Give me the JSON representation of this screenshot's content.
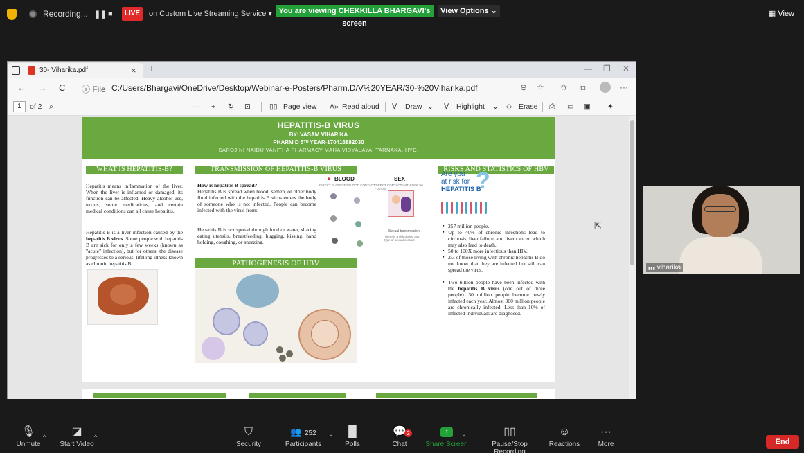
{
  "topbar": {
    "recording_label": "Recording...",
    "pause_icon": "❚❚",
    "stop_icon": "■",
    "live_label": "LIVE",
    "stream_label": "on Custom Live Streaming Service",
    "stream_caret": "▾",
    "viewing_label": "You are viewing CHEKKILLA BHARGAVI's screen",
    "view_options_label": "View Options ⌄",
    "view_label": "▦ View"
  },
  "browser": {
    "tab_title": "30- Viharika.pdf",
    "tab_close": "×",
    "new_tab": "+",
    "minimize": "—",
    "restore": "❐",
    "close": "✕",
    "back": "←",
    "forward": "→",
    "refresh": "C",
    "info": "ⓘ File",
    "url": "C:/Users/Bhargavi/OneDrive/Desktop/Webinar-e-Posters/Pharm.D/V%20YEAR/30-%20Viharika.pdf",
    "zoom_icon": "⊖",
    "fav_icon": "☆",
    "favs_icon": "✩",
    "collections_icon": "⧉",
    "more_icon": "···"
  },
  "pdf_toolbar": {
    "page_number": "1",
    "page_total": "of 2",
    "search_icon": "⌕",
    "zoom_out": "—",
    "zoom_in": "+",
    "rotate": "↻",
    "fit": "⊡",
    "page_view": "Page view",
    "page_view_icon": "▯▯",
    "read_aloud": "Read aloud",
    "read_aloud_icon": "A»",
    "draw": "Draw",
    "draw_icon": "∀",
    "draw_caret": "⌄",
    "highlight": "Highlight",
    "highlight_icon": "∀",
    "highlight_caret": "⌄",
    "erase": "Erase",
    "erase_icon": "◇",
    "print_icon": "⎙",
    "save_icon": "▭",
    "saveas_icon": "▣",
    "pin_icon": "✦"
  },
  "poster": {
    "title": "HEPATITIS-B VIRUS",
    "author": "BY: VASAM VIHARIKA",
    "year_line": "PHARM D 5ᵀᴴ YEAR-170416882030",
    "college": "SAROJINI NAIDU VANITHA PHARMACY MAHA VIDYALAYA, TARNAKA, HYD.",
    "what_head": "WHAT IS HEPATITIS-B?",
    "what_p1": "Hepatitis means inflammation of the liver. When the liver is inflamed or damaged, its function can be affected. Heavy alcohol use, toxins, some medications, and certain medical conditions can all cause hepatitis.",
    "what_p2a": "Hepatitis B is a liver infection caused by the ",
    "what_p2b": "hepatitis B virus",
    "what_p2c": ". Some people with hepatitis B are sick for only a few weeks (known as \"acute\" infection), but for others, the disease progresses to a serious, lifelong illness known as chronic hepatitis B.",
    "trans_head": "TRANSMISSION OF HEPATITIS-B VIRUS",
    "trans_q": "How is hepatitis B spread?",
    "trans_p1": "Hepatitis B is spread when blood, semen, or other body fluid infected with the hepatitis B virus enters the body of someone who is not infected. People can become infected with the virus from:",
    "trans_p2": "Hepatitis B is not spread through food or water, sharing eating utensils, breastfeeding, hugging, kissing, hand holding, coughing, or sneezing.",
    "ig_blood": "BLOOD",
    "ig_sex": "SEX",
    "ig_blood_sub": "DIRECT BLOOD TO BLOOD CONTACT",
    "ig_sex_sub": "DIRECT CONTACT WITH SEXUAL FLUIDS",
    "ig_sexual": "Sexual transmission",
    "ig_risk": "There is a risk during any type of sexual contact",
    "patho_head": "PATHOGENESIS OF HBV",
    "risk_head": "RISKS AND STATISTICS OF HBV",
    "risk_are_you": "Are you",
    "risk_at_risk": "at risk for",
    "risk_hepb": "HEPATITIS B",
    "risk_q": "?",
    "b1": "257 million people.",
    "b2": "Up to 40% of chronic infections lead to cirrhosis, liver failure, and liver cancer, which may also lead to death.",
    "b3": "50 to 100X more infectious than HIV.",
    "b4": "2/3 of those living with chronic hepatitis B do not know that they are infected but still can spread the virus.",
    "b5a": "Two billion people have been infected with the ",
    "b5b": "hepatitis B virus",
    "b5c": " (one out of three people). 30 million people become newly infected each year. Almost 300 million people are chronically infected. Less than 10% of infected individuals are diagnosed."
  },
  "participant": {
    "name": "viharika",
    "signal_icon": "▮▮▮"
  },
  "bottombar": {
    "unmute": "Unmute",
    "start_video": "Start Video",
    "security": "Security",
    "participants": "Participants",
    "participants_count": "252",
    "polls": "Polls",
    "chat": "Chat",
    "chat_badge": "2",
    "share": "Share Screen",
    "pause_rec": "Pause/Stop Recording",
    "reactions": "Reactions",
    "more": "More",
    "end": "End",
    "caret": "^",
    "mic_icon": "🎙",
    "video_icon": "◪",
    "security_icon": "⛉",
    "participants_icon": "👥",
    "polls_icon": "▐▌",
    "chat_icon": "💬",
    "share_icon": "↑",
    "pause_icon": "▯▯",
    "reactions_icon": "☺",
    "more_icon": "···"
  },
  "colors": {
    "poster_green": "#6aa840",
    "live_red": "#e02a2a",
    "zoom_green": "#23a23a",
    "end_red": "#d72828"
  }
}
